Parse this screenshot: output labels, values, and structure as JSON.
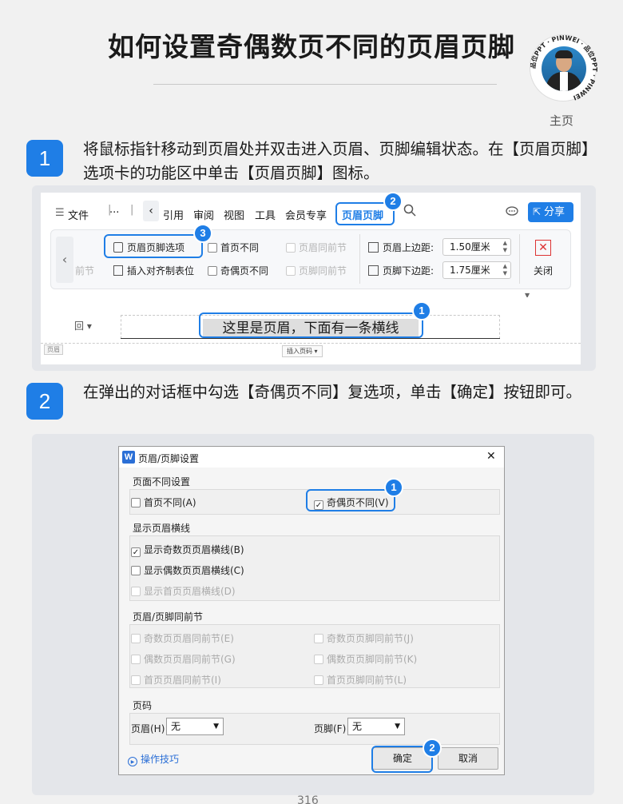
{
  "title": "如何设置奇偶数页不同的页眉页脚",
  "author": {
    "ring_text": "品位PPT · PINWEI · 品位PPT · PINWEI",
    "home_label": "主页"
  },
  "steps": [
    {
      "number": "1",
      "text": "将鼠标指针移动到页眉处并双击进入页眉、页脚编辑状态。在【页眉页脚】选项卡的功能区中单击【页眉页脚】图标。"
    },
    {
      "number": "2",
      "text": "在弹出的对话框中勾选【奇偶页不同】复选项，单击【确定】按钮即可。"
    }
  ],
  "toolbar": {
    "menu_icon": "☰",
    "file": "文件",
    "more": "···",
    "tabs": [
      "引用",
      "审阅",
      "视图",
      "工具",
      "会员专享",
      "页眉页脚"
    ],
    "search_icon": "search-icon",
    "share": "分享"
  },
  "ribbon": {
    "prev_section": "前节",
    "options_button": "页眉页脚选项",
    "insert_tab": "插入对齐制表位",
    "first_diff": "首页不同",
    "odd_even_diff": "奇偶页不同",
    "header_same_prev": "页眉同前节",
    "footer_same_prev": "页脚同前节",
    "header_top_label": "页眉上边距:",
    "header_top_value": "1.50厘米",
    "footer_bottom_label": "页脚下边距:",
    "footer_bottom_value": "1.75厘米",
    "close": "关闭"
  },
  "document": {
    "header_text": "这里是页眉，下面有一条横线",
    "header_tag": "页眉",
    "insert_page_number": "插入页码",
    "selector": "回"
  },
  "dialog": {
    "app_icon": "W",
    "title": "页眉/页脚设置",
    "close": "✕",
    "group_diff": "页面不同设置",
    "first_page_diff": "首页不同(A)",
    "odd_even_diff": "奇偶页不同(V)",
    "group_lines": "显示页眉横线",
    "show_odd_line": "显示奇数页页眉横线(B)",
    "show_even_line": "显示偶数页页眉横线(C)",
    "show_first_line": "显示首页页眉横线(D)",
    "group_same": "页眉/页脚同前节",
    "same_items_left": [
      "奇数页页眉同前节(E)",
      "偶数页页眉同前节(G)",
      "首页页眉同前节(I)"
    ],
    "same_items_right": [
      "奇数页页脚同前节(J)",
      "偶数页页脚同前节(K)",
      "首页页脚同前节(L)"
    ],
    "group_pageno": "页码",
    "header_label": "页眉(H)",
    "header_value": "无",
    "footer_label": "页脚(F)",
    "footer_value": "无",
    "tips": "操作技巧",
    "ok": "确定",
    "cancel": "取消"
  },
  "callouts": [
    "2",
    "3",
    "1",
    "1",
    "2"
  ],
  "page_number": "316",
  "colors": {
    "accent": "#1f7ee6"
  }
}
